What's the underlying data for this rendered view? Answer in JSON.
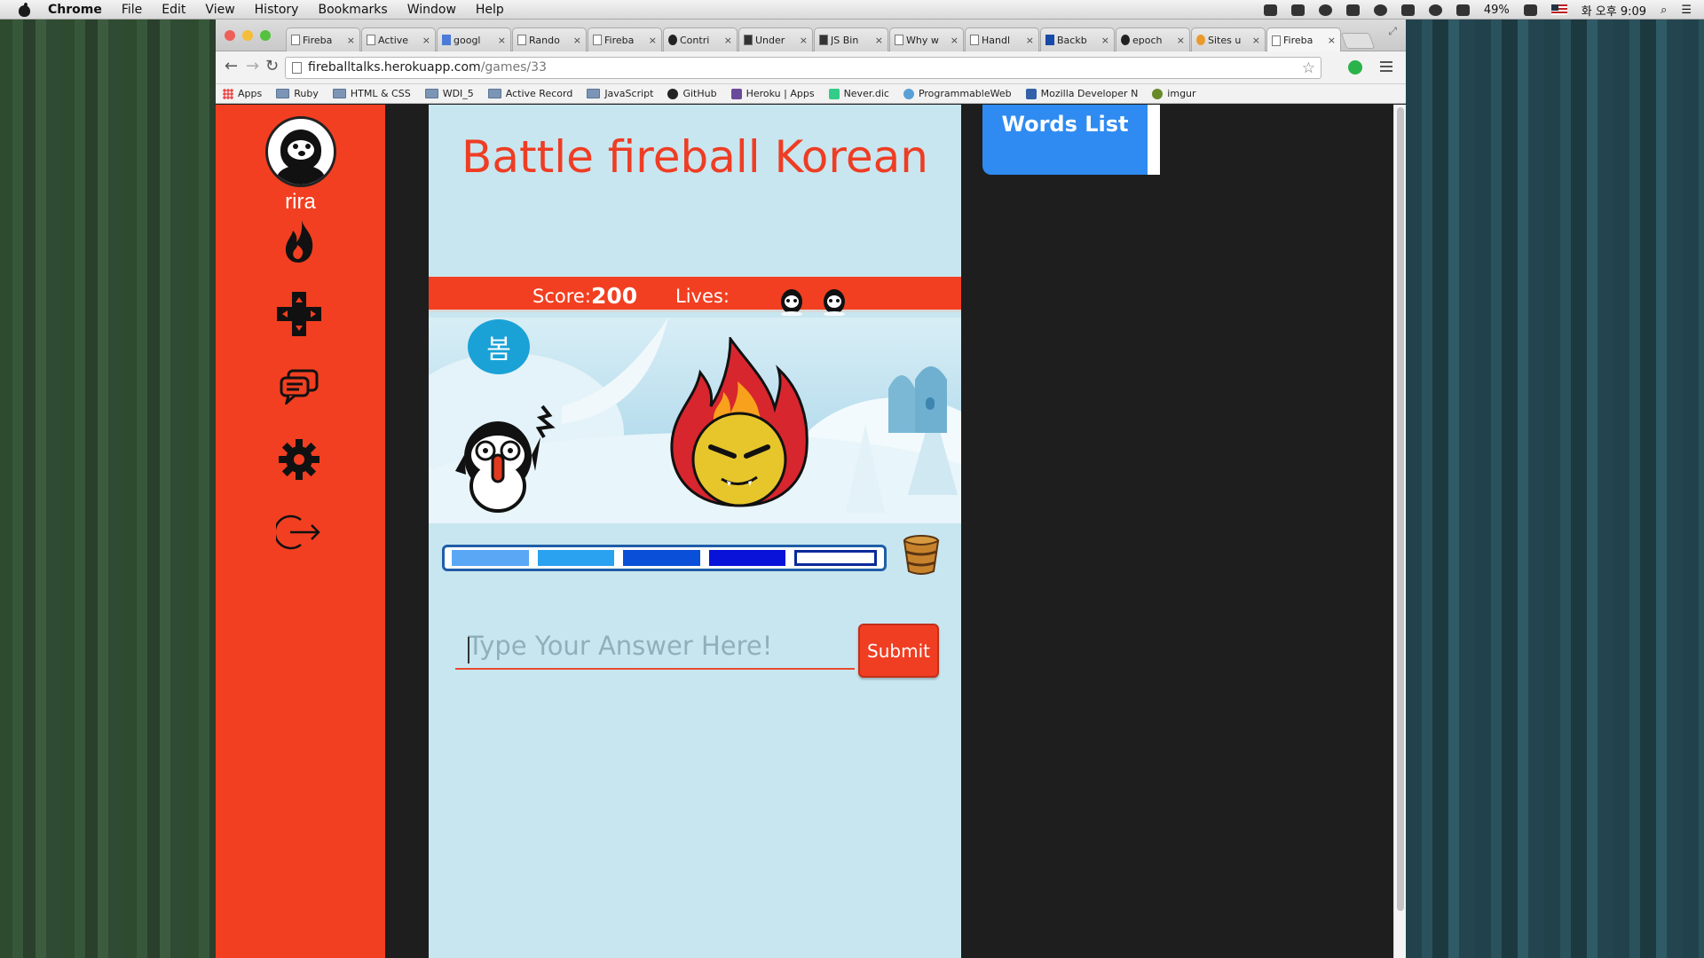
{
  "menubar": {
    "app": "Chrome",
    "items": [
      "File",
      "Edit",
      "View",
      "History",
      "Bookmarks",
      "Window",
      "Help"
    ],
    "battery": "49%",
    "clock": "화 오후 9:09"
  },
  "tabs": [
    {
      "title": "Fireba",
      "icon": "page-icon"
    },
    {
      "title": "Active",
      "icon": "page-icon"
    },
    {
      "title": "googl",
      "icon": "google-icon"
    },
    {
      "title": "Rando",
      "icon": "page-icon"
    },
    {
      "title": "Fireba",
      "icon": "page-icon"
    },
    {
      "title": "Contri",
      "icon": "github-icon"
    },
    {
      "title": "Under",
      "icon": "underscore-icon"
    },
    {
      "title": "JS Bin",
      "icon": "jsbin-icon"
    },
    {
      "title": "Why w",
      "icon": "page-icon"
    },
    {
      "title": "Handl",
      "icon": "page-icon"
    },
    {
      "title": "Backb",
      "icon": "backbone-icon"
    },
    {
      "title": "epoch",
      "icon": "github-icon"
    },
    {
      "title": "Sites u",
      "icon": "sites-icon"
    },
    {
      "title": "Fireba",
      "icon": "page-icon",
      "active": true
    }
  ],
  "address": {
    "host": "fireballtalks.herokuapp.com",
    "path": "/games/33"
  },
  "bookmarks": [
    {
      "label": "Apps",
      "icon": "apps-grid-icon"
    },
    {
      "label": "Ruby",
      "icon": "folder-icon"
    },
    {
      "label": "HTML & CSS",
      "icon": "folder-icon"
    },
    {
      "label": "WDI_5",
      "icon": "folder-icon"
    },
    {
      "label": "Active Record",
      "icon": "folder-icon"
    },
    {
      "label": "JavaScript",
      "icon": "folder-icon"
    },
    {
      "label": "GitHub",
      "icon": "github-icon"
    },
    {
      "label": "Heroku | Apps",
      "icon": "heroku-icon"
    },
    {
      "label": "Never.dic",
      "icon": "naver-icon"
    },
    {
      "label": "ProgrammableWeb",
      "icon": "programmableweb-icon"
    },
    {
      "label": "Mozilla Developer N",
      "icon": "mozilla-icon"
    },
    {
      "label": "imgur",
      "icon": "imgur-icon"
    }
  ],
  "sidebar": {
    "username": "rira",
    "icons": [
      "fire-icon",
      "gamepad-icon",
      "chat-icon",
      "gear-icon",
      "logout-icon"
    ]
  },
  "game": {
    "title": "Battle fireball Korean",
    "score_label": "Score:",
    "score": "200",
    "lives_label": "Lives:",
    "lives": 2,
    "word": "봄",
    "progress": {
      "segments": 5,
      "filled": 4,
      "colors": [
        "#5aa8f5",
        "#2aa2f0",
        "#0a4fd8",
        "#0812d8"
      ]
    },
    "answer_placeholder": "Type Your Answer Here!",
    "submit_label": "Submit"
  },
  "words_list_label": "Words List",
  "colors": {
    "primary_red": "#f23f21",
    "panel_blue": "#c8e6ef",
    "button_blue": "#2f8bf1"
  }
}
